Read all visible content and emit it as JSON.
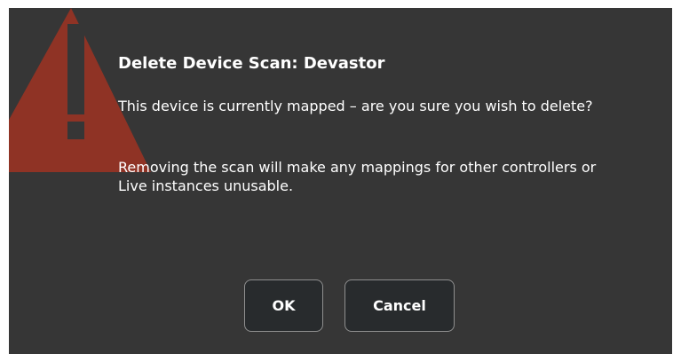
{
  "dialog": {
    "title": "Delete Device Scan: Devastor",
    "message_1": "This device is currently mapped – are you sure you wish to delete?",
    "message_2": "Removing the scan will make any mappings for other controllers or Live instances unusable.",
    "icon": "warning-icon"
  },
  "buttons": {
    "ok_label": "OK",
    "cancel_label": "Cancel"
  },
  "colors": {
    "background": "#363636",
    "warning": "#8f3325",
    "text": "#ffffff",
    "button_background": "#282b2d",
    "button_border": "#8f8f8f"
  }
}
